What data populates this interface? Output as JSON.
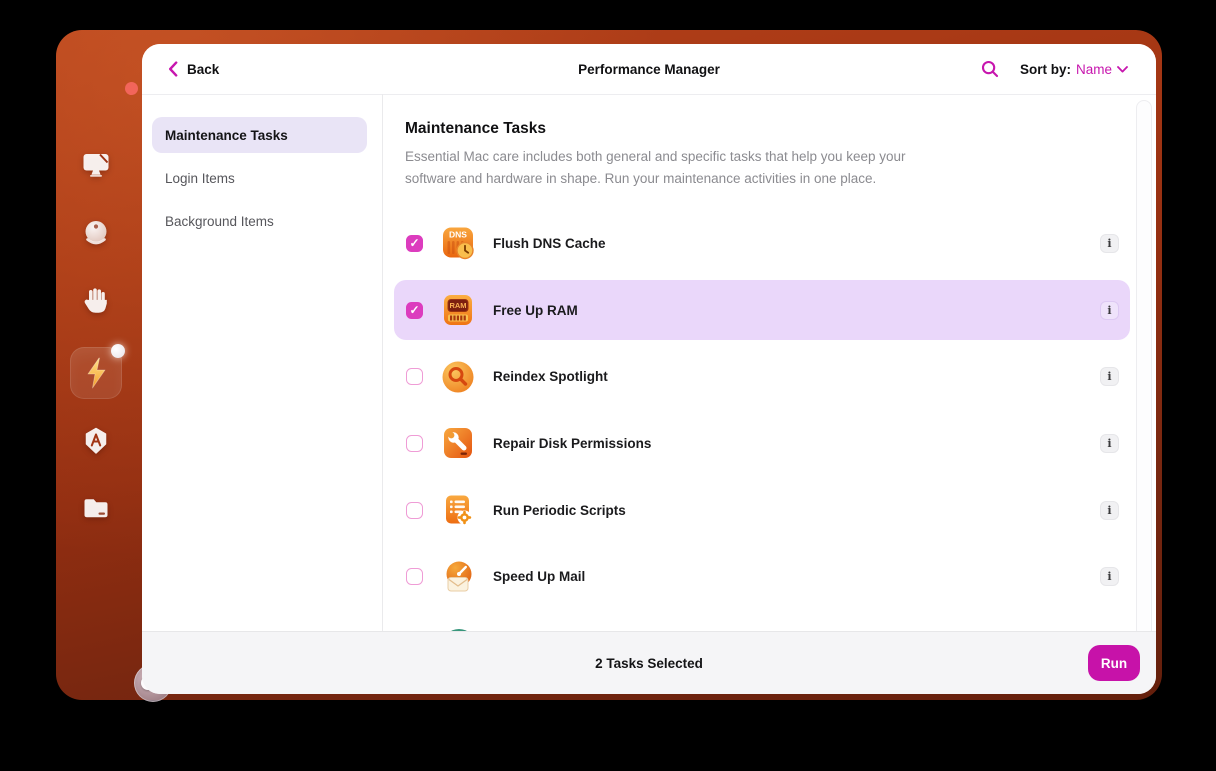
{
  "header": {
    "back_label": "Back",
    "title": "Performance Manager",
    "sort_label": "Sort by:",
    "sort_value": "Name"
  },
  "nav": {
    "items": [
      {
        "label": "Maintenance Tasks",
        "selected": true
      },
      {
        "label": "Login Items",
        "selected": false
      },
      {
        "label": "Background Items",
        "selected": false
      }
    ]
  },
  "content": {
    "heading": "Maintenance Tasks",
    "description": "Essential Mac care includes both general and specific tasks that help you keep your software and hardware in shape. Run your maintenance activities in one place.",
    "info_glyph": "i"
  },
  "tasks": [
    {
      "label": "Flush DNS Cache",
      "icon": "dns-cache-icon",
      "checked": true,
      "highlighted": false
    },
    {
      "label": "Free Up RAM",
      "icon": "free-up-ram-icon",
      "checked": true,
      "highlighted": true
    },
    {
      "label": "Reindex Spotlight",
      "icon": "reindex-spotlight-icon",
      "checked": false,
      "highlighted": false
    },
    {
      "label": "Repair Disk Permissions",
      "icon": "repair-disk-icon",
      "checked": false,
      "highlighted": false
    },
    {
      "label": "Run Periodic Scripts",
      "icon": "periodic-scripts-icon",
      "checked": false,
      "highlighted": false
    },
    {
      "label": "Speed Up Mail",
      "icon": "speed-up-mail-icon",
      "checked": false,
      "highlighted": false
    },
    {
      "label": "",
      "icon": "teal-partial-icon",
      "checked": false,
      "highlighted": false,
      "partial": true
    }
  ],
  "footer": {
    "status": "2 Tasks Selected",
    "run_label": "Run"
  },
  "dock": {
    "items": [
      {
        "icon": "display-cleanup-icon",
        "active": false,
        "badge": false
      },
      {
        "icon": "protection-orb-icon",
        "active": false,
        "badge": false
      },
      {
        "icon": "hand-privacy-icon",
        "active": false,
        "badge": false
      },
      {
        "icon": "lightning-performance-icon",
        "active": true,
        "badge": true
      },
      {
        "icon": "applications-icon",
        "active": false,
        "badge": false
      },
      {
        "icon": "folder-clutter-icon",
        "active": false,
        "badge": false
      }
    ]
  },
  "colors": {
    "accent": "#c716ae",
    "run_button": "#c712a9",
    "checkbox_checked": "#dc3cbe",
    "row_highlight": "#ead7fa",
    "nav_selected": "#e9e4f6",
    "traffic_red": "#f2655b",
    "traffic_yellow": "#f6c04f",
    "traffic_green": "#3ec455"
  }
}
